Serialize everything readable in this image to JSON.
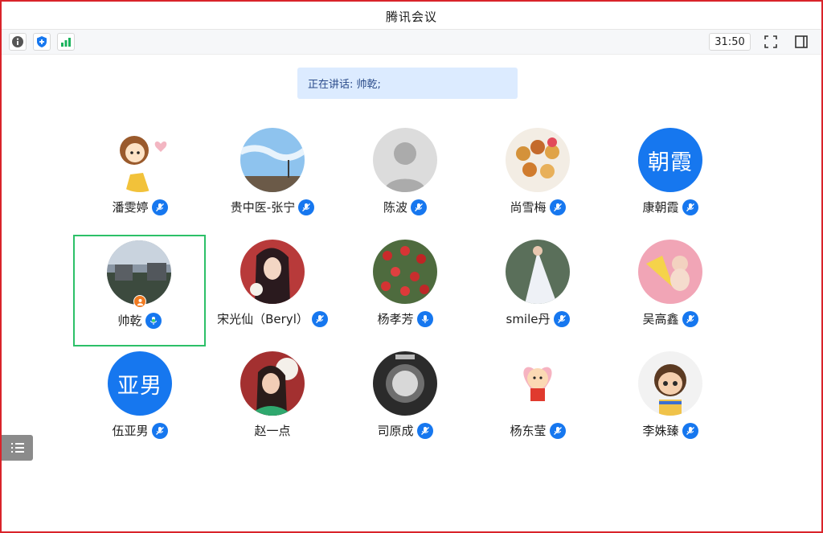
{
  "window": {
    "title": "腾讯会议"
  },
  "toolbar": {
    "timer": "31:50"
  },
  "speaking": {
    "text": "正在讲话: 帅乾;"
  },
  "participants": [
    {
      "name": "潘雯婷"
    },
    {
      "name": "贵中医-张宁"
    },
    {
      "name": "陈波"
    },
    {
      "name": "尚雪梅"
    },
    {
      "name": "康朝霞",
      "avatar_text": "朝霞"
    },
    {
      "name": "帅乾"
    },
    {
      "name": "宋光仙（Beryl）"
    },
    {
      "name": "杨孝芳"
    },
    {
      "name": "smile丹"
    },
    {
      "name": "吴高鑫"
    },
    {
      "name": "伍亚男",
      "avatar_text": "亚男"
    },
    {
      "name": "赵一点"
    },
    {
      "name": "司原成"
    },
    {
      "name": "杨东莹"
    },
    {
      "name": "李姝臻"
    }
  ],
  "colors": {
    "accent": "#1677ef",
    "active_border": "#2cc068",
    "host_badge": "#f07a21",
    "frame": "#d9232a"
  }
}
